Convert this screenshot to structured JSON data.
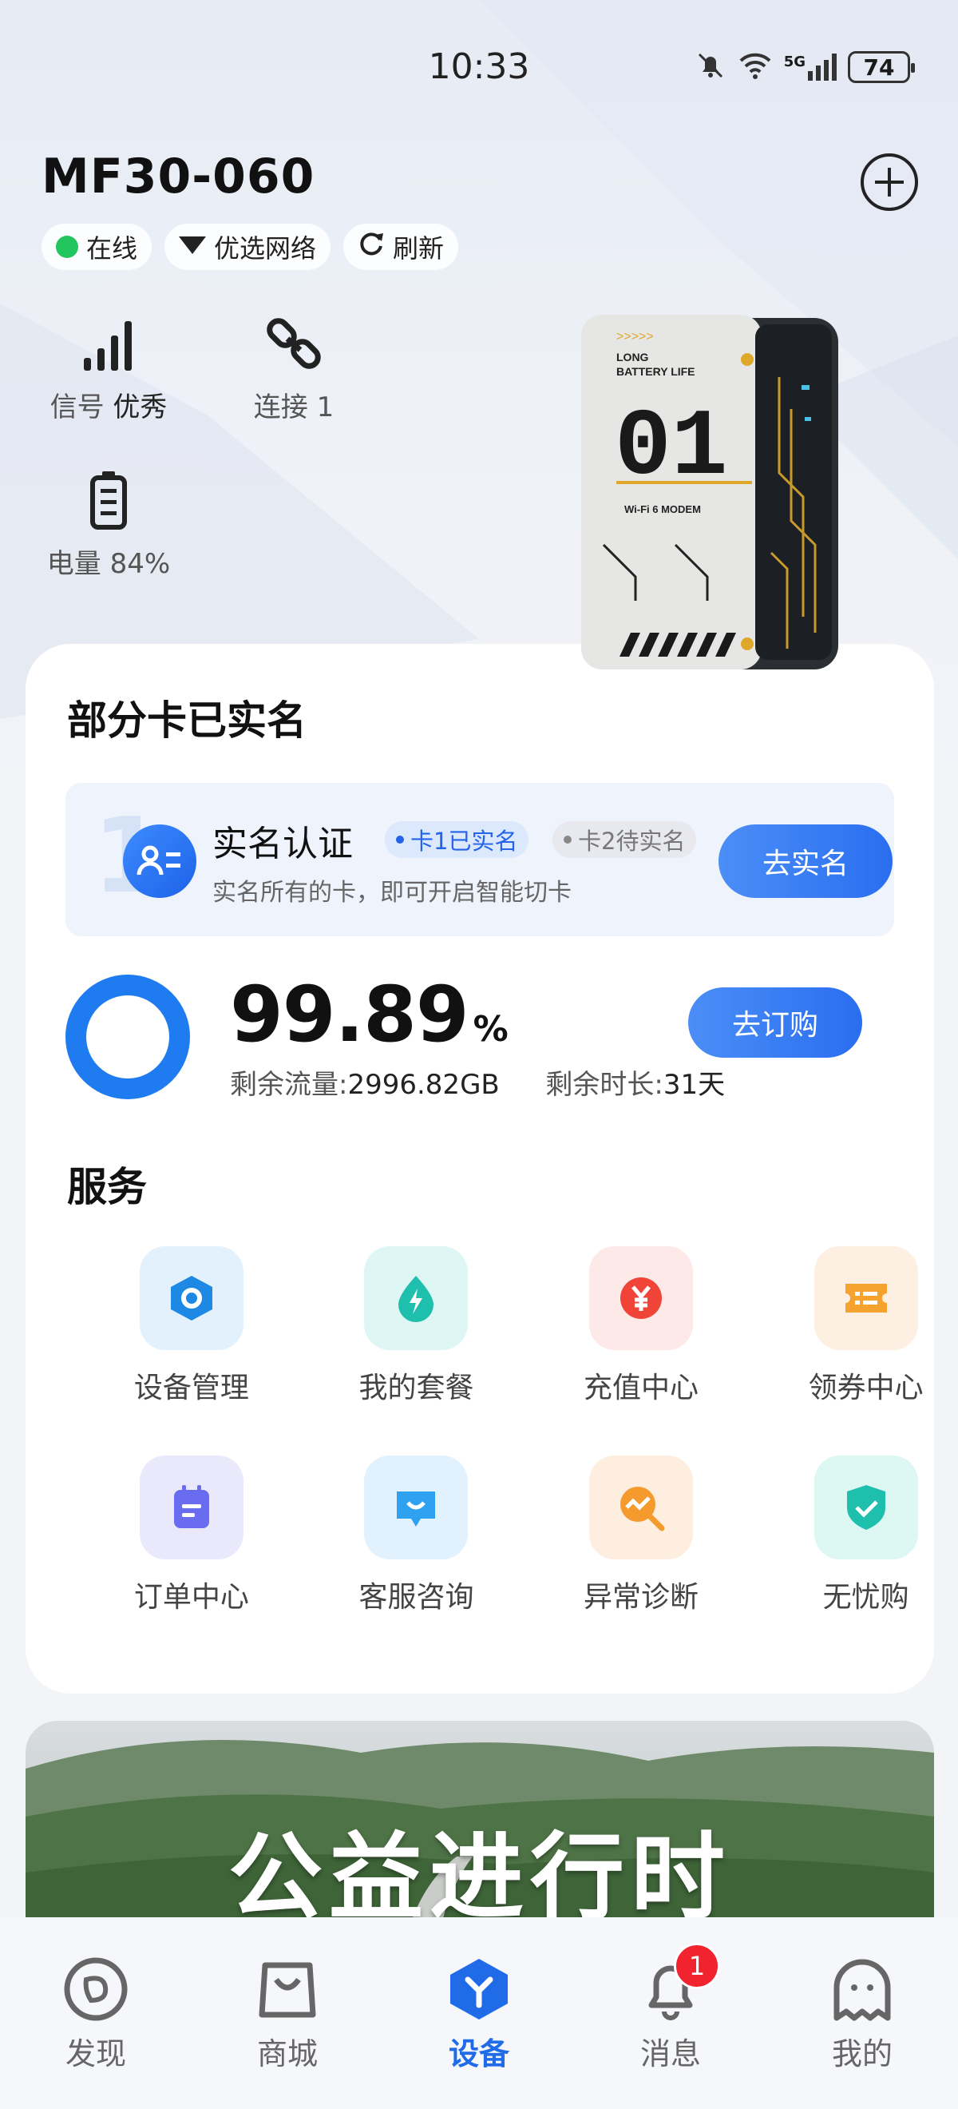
{
  "status_bar": {
    "time": "10:33",
    "network_label": "5G",
    "battery_level": "74"
  },
  "device": {
    "name": "MF30-060",
    "chips": {
      "online": "在线",
      "network": "优选网络",
      "refresh": "刷新"
    },
    "stats": {
      "signal_key": "信号",
      "signal_value": "优秀",
      "connections": "连接 1",
      "battery": "电量 84%"
    },
    "image_text": {
      "line1": "LONG",
      "line2": "BATTERY LIFE",
      "number": "01",
      "wifi": "Wi-Fi 6 MODEM"
    }
  },
  "card": {
    "title": "部分卡已实名",
    "realname": {
      "title": "实名认证",
      "tag_done": "卡1已实名",
      "tag_pending": "卡2待实名",
      "subtitle": "实名所有的卡，即可开启智能切卡",
      "button": "去实名"
    },
    "usage": {
      "percent": "99.89",
      "percent_value": 99.89,
      "unit": "%",
      "data_key": "剩余流量:",
      "data_value": "2996.82GB",
      "time_key": "剩余时长:",
      "time_value": "31天",
      "button": "去订购"
    },
    "services_title": "服务",
    "services": [
      {
        "label": "设备管理",
        "icon": "device-manage-icon",
        "bg": "#e3f1fd",
        "color": "#1e88e5"
      },
      {
        "label": "我的套餐",
        "icon": "plan-icon",
        "bg": "#dff7f4",
        "color": "#1fbfae"
      },
      {
        "label": "充值中心",
        "icon": "recharge-icon",
        "bg": "#fde9e7",
        "color": "#f04438"
      },
      {
        "label": "领券中心",
        "icon": "coupon-icon",
        "bg": "#fdf0e2",
        "color": "#f5a22f"
      },
      {
        "label": "订单中心",
        "icon": "order-icon",
        "bg": "#e9e9fb",
        "color": "#6a6cf0"
      },
      {
        "label": "客服咨询",
        "icon": "service-chat-icon",
        "bg": "#e1f1fd",
        "color": "#2ea1f0"
      },
      {
        "label": "异常诊断",
        "icon": "diagnose-icon",
        "bg": "#fdeee0",
        "color": "#f59b2e"
      },
      {
        "label": "无忧购",
        "icon": "shield-check-icon",
        "bg": "#ddf7f3",
        "color": "#1fbfae"
      }
    ]
  },
  "banner": {
    "text": "公益进行时"
  },
  "bottom_nav": {
    "items": [
      {
        "label": "发现",
        "icon": "discover-icon"
      },
      {
        "label": "商城",
        "icon": "shop-bag-icon"
      },
      {
        "label": "设备",
        "icon": "device-icon"
      },
      {
        "label": "消息",
        "icon": "bell-icon"
      },
      {
        "label": "我的",
        "icon": "profile-icon"
      }
    ],
    "active": "设备",
    "message_badge": "1"
  },
  "colors": {
    "accent": "#1f6be8",
    "online": "#22c55e",
    "badge": "#f0232e"
  }
}
